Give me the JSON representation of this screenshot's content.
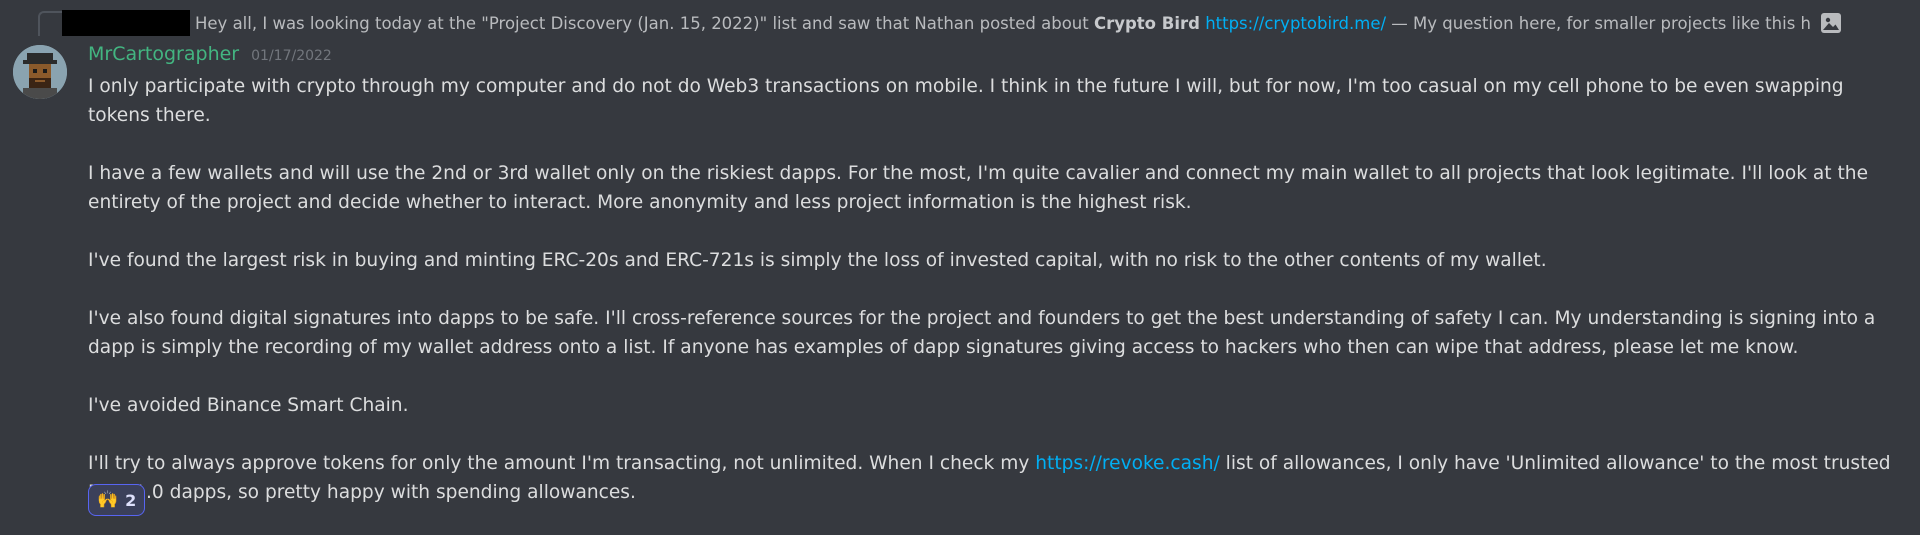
{
  "reply": {
    "text_before": "Hey all, I was looking today at the \"Project Discovery (Jan. 15, 2022)\" list and saw that Nathan posted about ",
    "bold": "Crypto Bird",
    "link": "https://cryptobird.me/",
    "text_after": " — My question here, for smaller projects like this how you evaluate ...",
    "image_icon": "image-icon"
  },
  "message": {
    "username": "MrCartographer",
    "timestamp": "01/17/2022",
    "paragraphs": {
      "p1": "I only participate with crypto through my computer and do not do Web3 transactions on mobile. I think in the future I will, but for now, I'm too casual on my cell phone to be even swapping tokens there.",
      "p2": "I have a few wallets and will use the 2nd or 3rd wallet only on the riskiest dapps. For the most, I'm quite cavalier and connect my main wallet to all projects that look legitimate. I'll look at the entirety of the project and decide whether to interact. More anonymity and less project information is the highest risk.",
      "p3": "I've found the largest risk in buying and minting ERC-20s and ERC-721s is simply the loss of invested capital, with no risk to the other contents of my wallet.",
      "p4": "I've also found digital signatures into dapps to be safe. I'll cross-reference sources for the project and founders to get the best understanding of safety I can. My understanding is signing into a dapp is simply the recording of my wallet address onto a list. If anyone has examples of dapp signatures giving access to hackers who then can wipe that address, please let me know.",
      "p5": "I've avoided Binance Smart Chain.",
      "p6_before": "I'll try to always approve tokens for only the amount I'm transacting, not unlimited. When I check my ",
      "p6_link": "https://revoke.cash/",
      "p6_after": " list of allowances, I only have 'Unlimited allowance' to the most trusted DeFi 1.0 dapps, so pretty happy with spending allowances."
    }
  },
  "reaction": {
    "emoji": "🙌",
    "count": "2"
  },
  "colors": {
    "background": "#36393f",
    "username": "#43b581",
    "link": "#00aff4",
    "reaction_border": "#5865f2"
  }
}
